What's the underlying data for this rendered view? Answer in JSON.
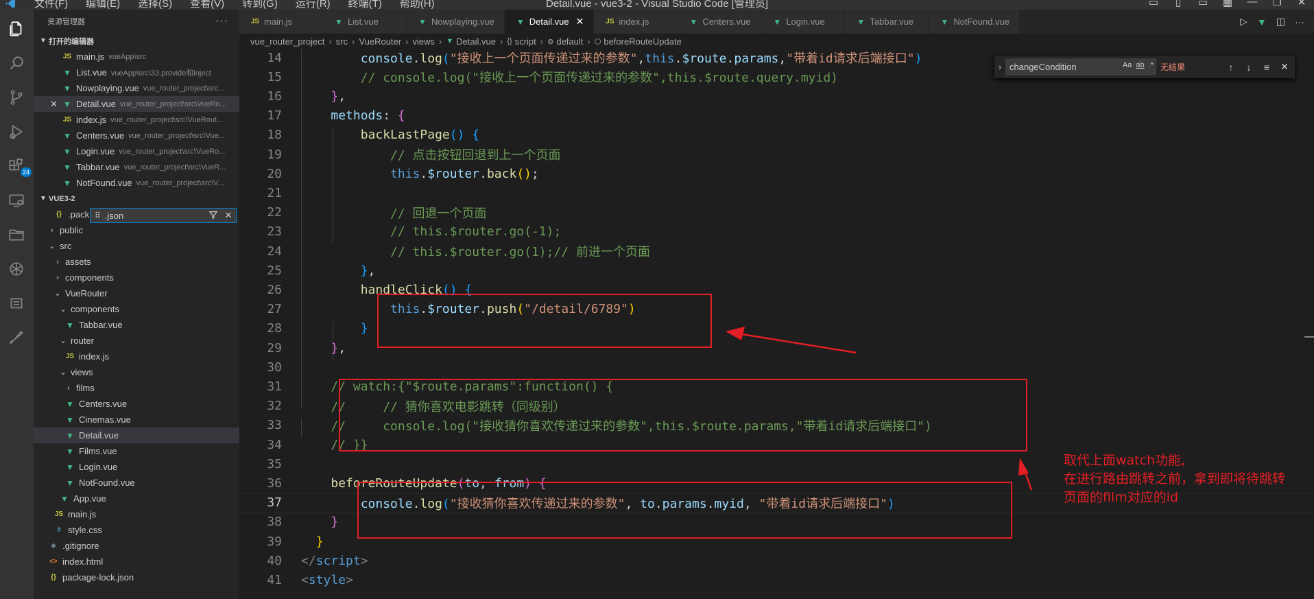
{
  "titlebar": {
    "menu": [
      "文件(F)",
      "编辑(E)",
      "选择(S)",
      "查看(V)",
      "转到(G)",
      "运行(R)",
      "终端(T)",
      "帮助(H)"
    ],
    "window_title": "Detail.vue - vue3-2 - Visual Studio Code [管理员]"
  },
  "activitybar": {
    "icons": [
      "explorer-icon",
      "search-icon",
      "source-control-icon",
      "run-debug-icon",
      "extensions-icon",
      "remote-explorer-icon",
      "folder-icon",
      "openai-icon",
      "list-icon",
      "brush-icon"
    ],
    "extensions_badge": "24"
  },
  "sidebar": {
    "header": "资源管理器",
    "more": "···",
    "open_editors": {
      "title": "打开的编辑器",
      "items": [
        {
          "icon": "JS",
          "type": "js",
          "name": "main.js",
          "path": "vueApp\\src"
        },
        {
          "icon": "▼",
          "type": "vue",
          "name": "List.vue",
          "path": "vueApp\\src\\33.provide和inject"
        },
        {
          "icon": "▼",
          "type": "vue",
          "name": "Nowplaying.vue",
          "path": "vue_router_project\\src..."
        },
        {
          "icon": "▼",
          "type": "vue",
          "name": "Detail.vue",
          "path": "vue_router_project\\src\\VueRo..."
        },
        {
          "icon": "JS",
          "type": "js",
          "name": "index.js",
          "path": "vue_router_project\\src\\VueRout..."
        },
        {
          "icon": "▼",
          "type": "vue",
          "name": "Centers.vue",
          "path": "vue_router_project\\src\\Vue..."
        },
        {
          "icon": "▼",
          "type": "vue",
          "name": "Login.vue",
          "path": "vue_router_project\\src\\VueRo..."
        },
        {
          "icon": "▼",
          "type": "vue",
          "name": "Tabbar.vue",
          "path": "vue_router_project\\src\\VueR..."
        },
        {
          "icon": "▼",
          "type": "vue",
          "name": "NotFound.vue",
          "path": "vue_router_project\\src\\V..."
        }
      ]
    },
    "workspace": {
      "title": "VUE3-2",
      "filter_value": ".json",
      "first_item": ".pack",
      "tree": [
        {
          "level": 1,
          "twist": "›",
          "name": "public"
        },
        {
          "level": 1,
          "twist": "⌄",
          "name": "src"
        },
        {
          "level": 2,
          "twist": "›",
          "name": "assets"
        },
        {
          "level": 2,
          "twist": "›",
          "name": "components"
        },
        {
          "level": 2,
          "twist": "⌄",
          "name": "VueRouter"
        },
        {
          "level": 3,
          "twist": "⌄",
          "name": "components"
        },
        {
          "level": 4,
          "icon": "▼",
          "type": "vue",
          "name": "Tabbar.vue"
        },
        {
          "level": 3,
          "twist": "⌄",
          "name": "router"
        },
        {
          "level": 4,
          "icon": "JS",
          "type": "js",
          "name": "index.js"
        },
        {
          "level": 3,
          "twist": "⌄",
          "name": "views"
        },
        {
          "level": 4,
          "twist": "›",
          "name": "films"
        },
        {
          "level": 4,
          "icon": "▼",
          "type": "vue",
          "name": "Centers.vue"
        },
        {
          "level": 4,
          "icon": "▼",
          "type": "vue",
          "name": "Cinemas.vue"
        },
        {
          "level": 4,
          "icon": "▼",
          "type": "vue",
          "name": "Detail.vue"
        },
        {
          "level": 4,
          "icon": "▼",
          "type": "vue",
          "name": "Films.vue"
        },
        {
          "level": 4,
          "icon": "▼",
          "type": "vue",
          "name": "Login.vue"
        },
        {
          "level": 4,
          "icon": "▼",
          "type": "vue",
          "name": "NotFound.vue"
        },
        {
          "level": 3,
          "icon": "▼",
          "type": "vue",
          "name": "App.vue"
        },
        {
          "level": 2,
          "icon": "JS",
          "type": "js",
          "name": "main.js"
        },
        {
          "level": 2,
          "icon": "#",
          "type": "css",
          "name": "style.css"
        },
        {
          "level": 1,
          "icon": "◆",
          "type": "git",
          "name": ".gitignore"
        },
        {
          "level": 1,
          "icon": "<>",
          "type": "html",
          "name": "index.html"
        },
        {
          "level": 1,
          "icon": "{}",
          "type": "json",
          "name": "package-lock.json"
        }
      ]
    }
  },
  "tabs": [
    {
      "icon": "JS",
      "type": "js",
      "label": "main.js"
    },
    {
      "icon": "▼",
      "type": "vue",
      "label": "List.vue"
    },
    {
      "icon": "▼",
      "type": "vue",
      "label": "Nowplaying.vue"
    },
    {
      "icon": "▼",
      "type": "vue",
      "label": "Detail.vue",
      "active": true
    },
    {
      "icon": "JS",
      "type": "js",
      "label": "index.js"
    },
    {
      "icon": "▼",
      "type": "vue",
      "label": "Centers.vue"
    },
    {
      "icon": "▼",
      "type": "vue",
      "label": "Login.vue"
    },
    {
      "icon": "▼",
      "type": "vue",
      "label": "Tabbar.vue"
    },
    {
      "icon": "▼",
      "type": "vue",
      "label": "NotFound.vue"
    }
  ],
  "breadcrumb": [
    "vue_router_project",
    "src",
    "VueRouter",
    "views",
    "Detail.vue",
    "script",
    "default",
    "beforeRouteUpdate"
  ],
  "find": {
    "value": "changeCondition",
    "options": [
      "Aa",
      "ab",
      ".*"
    ],
    "result": "无结果"
  },
  "editor": {
    "current_line": 37,
    "lines": [
      {
        "n": "14",
        "tokens": [
          [
            "",
            "        "
          ],
          [
            "c-var",
            "console"
          ],
          [
            "",
            "."
          ],
          [
            "c-fn",
            "log"
          ],
          [
            "c-b3",
            "("
          ],
          [
            "c-str",
            "\"接收上一个页面传递过来的参数\""
          ],
          [
            "",
            ","
          ],
          [
            "c-kw",
            "this"
          ],
          [
            "",
            "."
          ],
          [
            "c-var",
            "$route"
          ],
          [
            "",
            "."
          ],
          [
            "c-var",
            "params"
          ],
          [
            "",
            ","
          ],
          [
            "c-str",
            "\"带着id请求后端接口\""
          ],
          [
            "c-b3",
            ")"
          ]
        ]
      },
      {
        "n": "15",
        "tokens": [
          [
            "",
            "        "
          ],
          [
            "c-cm",
            "// console.log(\"接收上一个页面传递过来的参数\",this.$route.query.myid)"
          ]
        ]
      },
      {
        "n": "16",
        "tokens": [
          [
            "",
            "    "
          ],
          [
            "c-b2",
            "}"
          ],
          [
            "",
            ","
          ]
        ]
      },
      {
        "n": "17",
        "tokens": [
          [
            "",
            "    "
          ],
          [
            "c-var",
            "methods"
          ],
          [
            "",
            ": "
          ],
          [
            "c-b2",
            "{"
          ]
        ]
      },
      {
        "n": "18",
        "tokens": [
          [
            "",
            "        "
          ],
          [
            "c-fn",
            "backLastPage"
          ],
          [
            "c-b3",
            "()"
          ],
          [
            "",
            " "
          ],
          [
            "c-b3",
            "{"
          ]
        ]
      },
      {
        "n": "19",
        "tokens": [
          [
            "",
            "            "
          ],
          [
            "c-cm",
            "// 点击按钮回退到上一个页面"
          ]
        ]
      },
      {
        "n": "20",
        "tokens": [
          [
            "",
            "            "
          ],
          [
            "c-kw",
            "this"
          ],
          [
            "",
            "."
          ],
          [
            "c-var",
            "$router"
          ],
          [
            "",
            "."
          ],
          [
            "c-fn",
            "back"
          ],
          [
            "c-b1",
            "()"
          ],
          [
            "",
            ";"
          ]
        ]
      },
      {
        "n": "21",
        "tokens": [
          [
            "",
            ""
          ]
        ]
      },
      {
        "n": "22",
        "tokens": [
          [
            "",
            "            "
          ],
          [
            "c-cm",
            "// 回退一个页面"
          ]
        ]
      },
      {
        "n": "23",
        "tokens": [
          [
            "",
            "            "
          ],
          [
            "c-cm",
            "// this.$router.go(-1);"
          ]
        ]
      },
      {
        "n": "24",
        "tokens": [
          [
            "",
            "            "
          ],
          [
            "c-cm",
            "// this.$router.go(1);// 前进一个页面"
          ]
        ]
      },
      {
        "n": "25",
        "tokens": [
          [
            "",
            "        "
          ],
          [
            "c-b3",
            "}"
          ],
          [
            "",
            ","
          ]
        ]
      },
      {
        "n": "26",
        "tokens": [
          [
            "",
            "        "
          ],
          [
            "c-fn",
            "handleClick"
          ],
          [
            "c-b3",
            "()"
          ],
          [
            "",
            " "
          ],
          [
            "c-b3",
            "{"
          ]
        ]
      },
      {
        "n": "27",
        "tokens": [
          [
            "",
            "            "
          ],
          [
            "c-kw",
            "this"
          ],
          [
            "",
            "."
          ],
          [
            "c-var",
            "$router"
          ],
          [
            "",
            "."
          ],
          [
            "c-fn",
            "push"
          ],
          [
            "c-b1",
            "("
          ],
          [
            "c-str",
            "\"/detail/6789\""
          ],
          [
            "c-b1",
            ")"
          ]
        ]
      },
      {
        "n": "28",
        "tokens": [
          [
            "",
            "        "
          ],
          [
            "c-b3",
            "}"
          ]
        ]
      },
      {
        "n": "29",
        "tokens": [
          [
            "",
            "    "
          ],
          [
            "c-b2",
            "}"
          ],
          [
            "",
            ","
          ]
        ]
      },
      {
        "n": "30",
        "tokens": [
          [
            "",
            ""
          ]
        ]
      },
      {
        "n": "31",
        "tokens": [
          [
            "",
            "    "
          ],
          [
            "c-cm",
            "// watch:{\"$route.params\":function() {"
          ]
        ]
      },
      {
        "n": "32",
        "tokens": [
          [
            "",
            "    "
          ],
          [
            "c-cm",
            "//     // 猜你喜欢电影跳转（同级别）"
          ]
        ]
      },
      {
        "n": "33",
        "tokens": [
          [
            "",
            "    "
          ],
          [
            "c-cm",
            "//     console.log(\"接收猜你喜欢传递过来的参数\",this.$route.params,\"带着id请求后端接口\")"
          ]
        ]
      },
      {
        "n": "34",
        "tokens": [
          [
            "",
            "    "
          ],
          [
            "c-cm",
            "// }}"
          ]
        ]
      },
      {
        "n": "35",
        "tokens": [
          [
            "",
            ""
          ]
        ]
      },
      {
        "n": "36",
        "tokens": [
          [
            "",
            "    "
          ],
          [
            "c-fn",
            "beforeRouteUpdate"
          ],
          [
            "c-b2",
            "("
          ],
          [
            "c-var",
            "to"
          ],
          [
            "",
            ", "
          ],
          [
            "c-var",
            "from"
          ],
          [
            "c-b2",
            ")"
          ],
          [
            "",
            " "
          ],
          [
            "c-b2",
            "{"
          ]
        ]
      },
      {
        "n": "37",
        "tokens": [
          [
            "",
            "        "
          ],
          [
            "c-var",
            "console"
          ],
          [
            "",
            "."
          ],
          [
            "c-fn",
            "log"
          ],
          [
            "c-b3",
            "("
          ],
          [
            "c-str",
            "\"接收猜你喜欢传递过来的参数\""
          ],
          [
            "",
            ", "
          ],
          [
            "c-var",
            "to"
          ],
          [
            "",
            "."
          ],
          [
            "c-var",
            "params"
          ],
          [
            "",
            "."
          ],
          [
            "c-var",
            "myid"
          ],
          [
            "",
            ", "
          ],
          [
            "c-str",
            "\"带着id请求后端接口\""
          ],
          [
            "c-b3",
            ")"
          ]
        ]
      },
      {
        "n": "38",
        "tokens": [
          [
            "",
            "    "
          ],
          [
            "c-b2",
            "}"
          ]
        ]
      },
      {
        "n": "39",
        "tokens": [
          [
            "",
            "  "
          ],
          [
            "c-b1",
            "}"
          ]
        ]
      },
      {
        "n": "40",
        "tokens": [
          [
            "c-ang",
            "</"
          ],
          [
            "c-tag",
            "script"
          ],
          [
            "c-ang",
            ">"
          ]
        ]
      },
      {
        "n": "41",
        "tokens": [
          [
            "c-ang",
            "<"
          ],
          [
            "c-tag",
            "style"
          ],
          [
            "c-ang",
            ">"
          ]
        ]
      }
    ]
  },
  "annotation": {
    "lines": [
      "取代上面watch功能,",
      "在进行路由跳转之前，拿到即将待跳转",
      "页面的film对应的id"
    ],
    "color": "#e31e24"
  }
}
